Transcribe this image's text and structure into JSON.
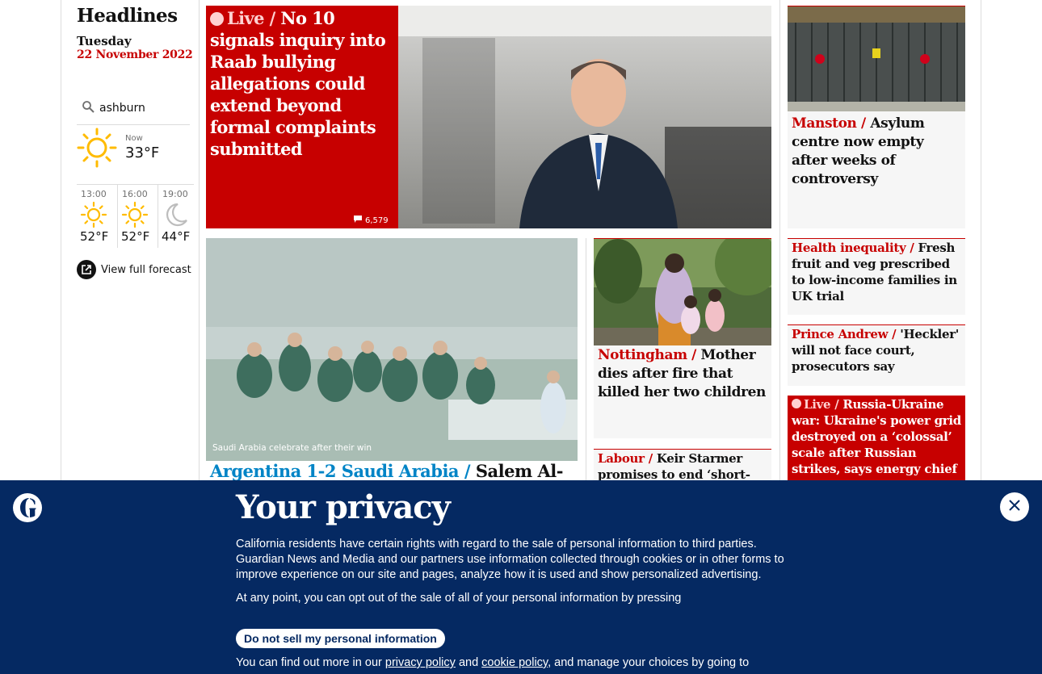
{
  "sidebar": {
    "title": "Headlines",
    "day": "Tuesday",
    "date": "22 November 2022",
    "weather": {
      "location": "ashburn",
      "now_label": "Now",
      "now_temp": "33°F",
      "now_icon": "sun-icon",
      "forecast": [
        {
          "time": "13:00",
          "temp": "52°F",
          "icon": "sun-icon"
        },
        {
          "time": "16:00",
          "temp": "52°F",
          "icon": "sun-icon"
        },
        {
          "time": "19:00",
          "temp": "44°F",
          "icon": "moon-icon"
        }
      ],
      "full_forecast_label": "View full forecast"
    }
  },
  "stories": {
    "lead": {
      "kicker": "Live /",
      "headline": "No 10 signals inquiry into Raab bullying allegations could extend beyond formal complaints submitted",
      "comments": "6,579"
    },
    "manston": {
      "kicker": "Manston /",
      "headline": "Asylum centre now empty after weeks of controversy"
    },
    "football": {
      "kicker": "Argentina 1-2 Saudi Arabia /",
      "headline": "Salem Al-",
      "caption": "Saudi Arabia celebrate after their win"
    },
    "nottingham": {
      "kicker": "Nottingham /",
      "headline": "Mother dies after fire that killed her two children"
    },
    "labour": {
      "kicker": "Labour /",
      "headline": "Keir Starmer promises to end ‘short-"
    },
    "health": {
      "kicker": "Health inequality /",
      "headline": "Fresh fruit and veg prescribed to low-income families in UK trial"
    },
    "andrew": {
      "kicker": "Prince Andrew /",
      "headline": "'Heckler' will not face court, prosecutors say"
    },
    "ukraine": {
      "kicker": "Live /",
      "headline": "Russia-Ukraine war: Ukraine's power grid destroyed on a ‘colossal’ scale after Russian strikes, says energy chief"
    }
  },
  "privacy": {
    "title": "Your privacy",
    "body1": "California residents have certain rights with regard to the sale of personal information to third parties. Guardian News and Media and our partners use information collected through cookies or in other forms to improve experience on our site and pages, analyze how it is used and show personalized advertising.",
    "body2": "At any point, you can opt out of the sale of all of your personal information by pressing",
    "button": "Do not sell my personal information",
    "more_prefix": "You can find out more in our",
    "privacy_link": "privacy policy",
    "and": "and",
    "cookie_link": "cookie policy",
    "more_suffix": ", and manage your choices by going to"
  },
  "colors": {
    "news_red": "#c70000",
    "sport_blue": "#0084c6",
    "privacy_navy": "#052962"
  }
}
